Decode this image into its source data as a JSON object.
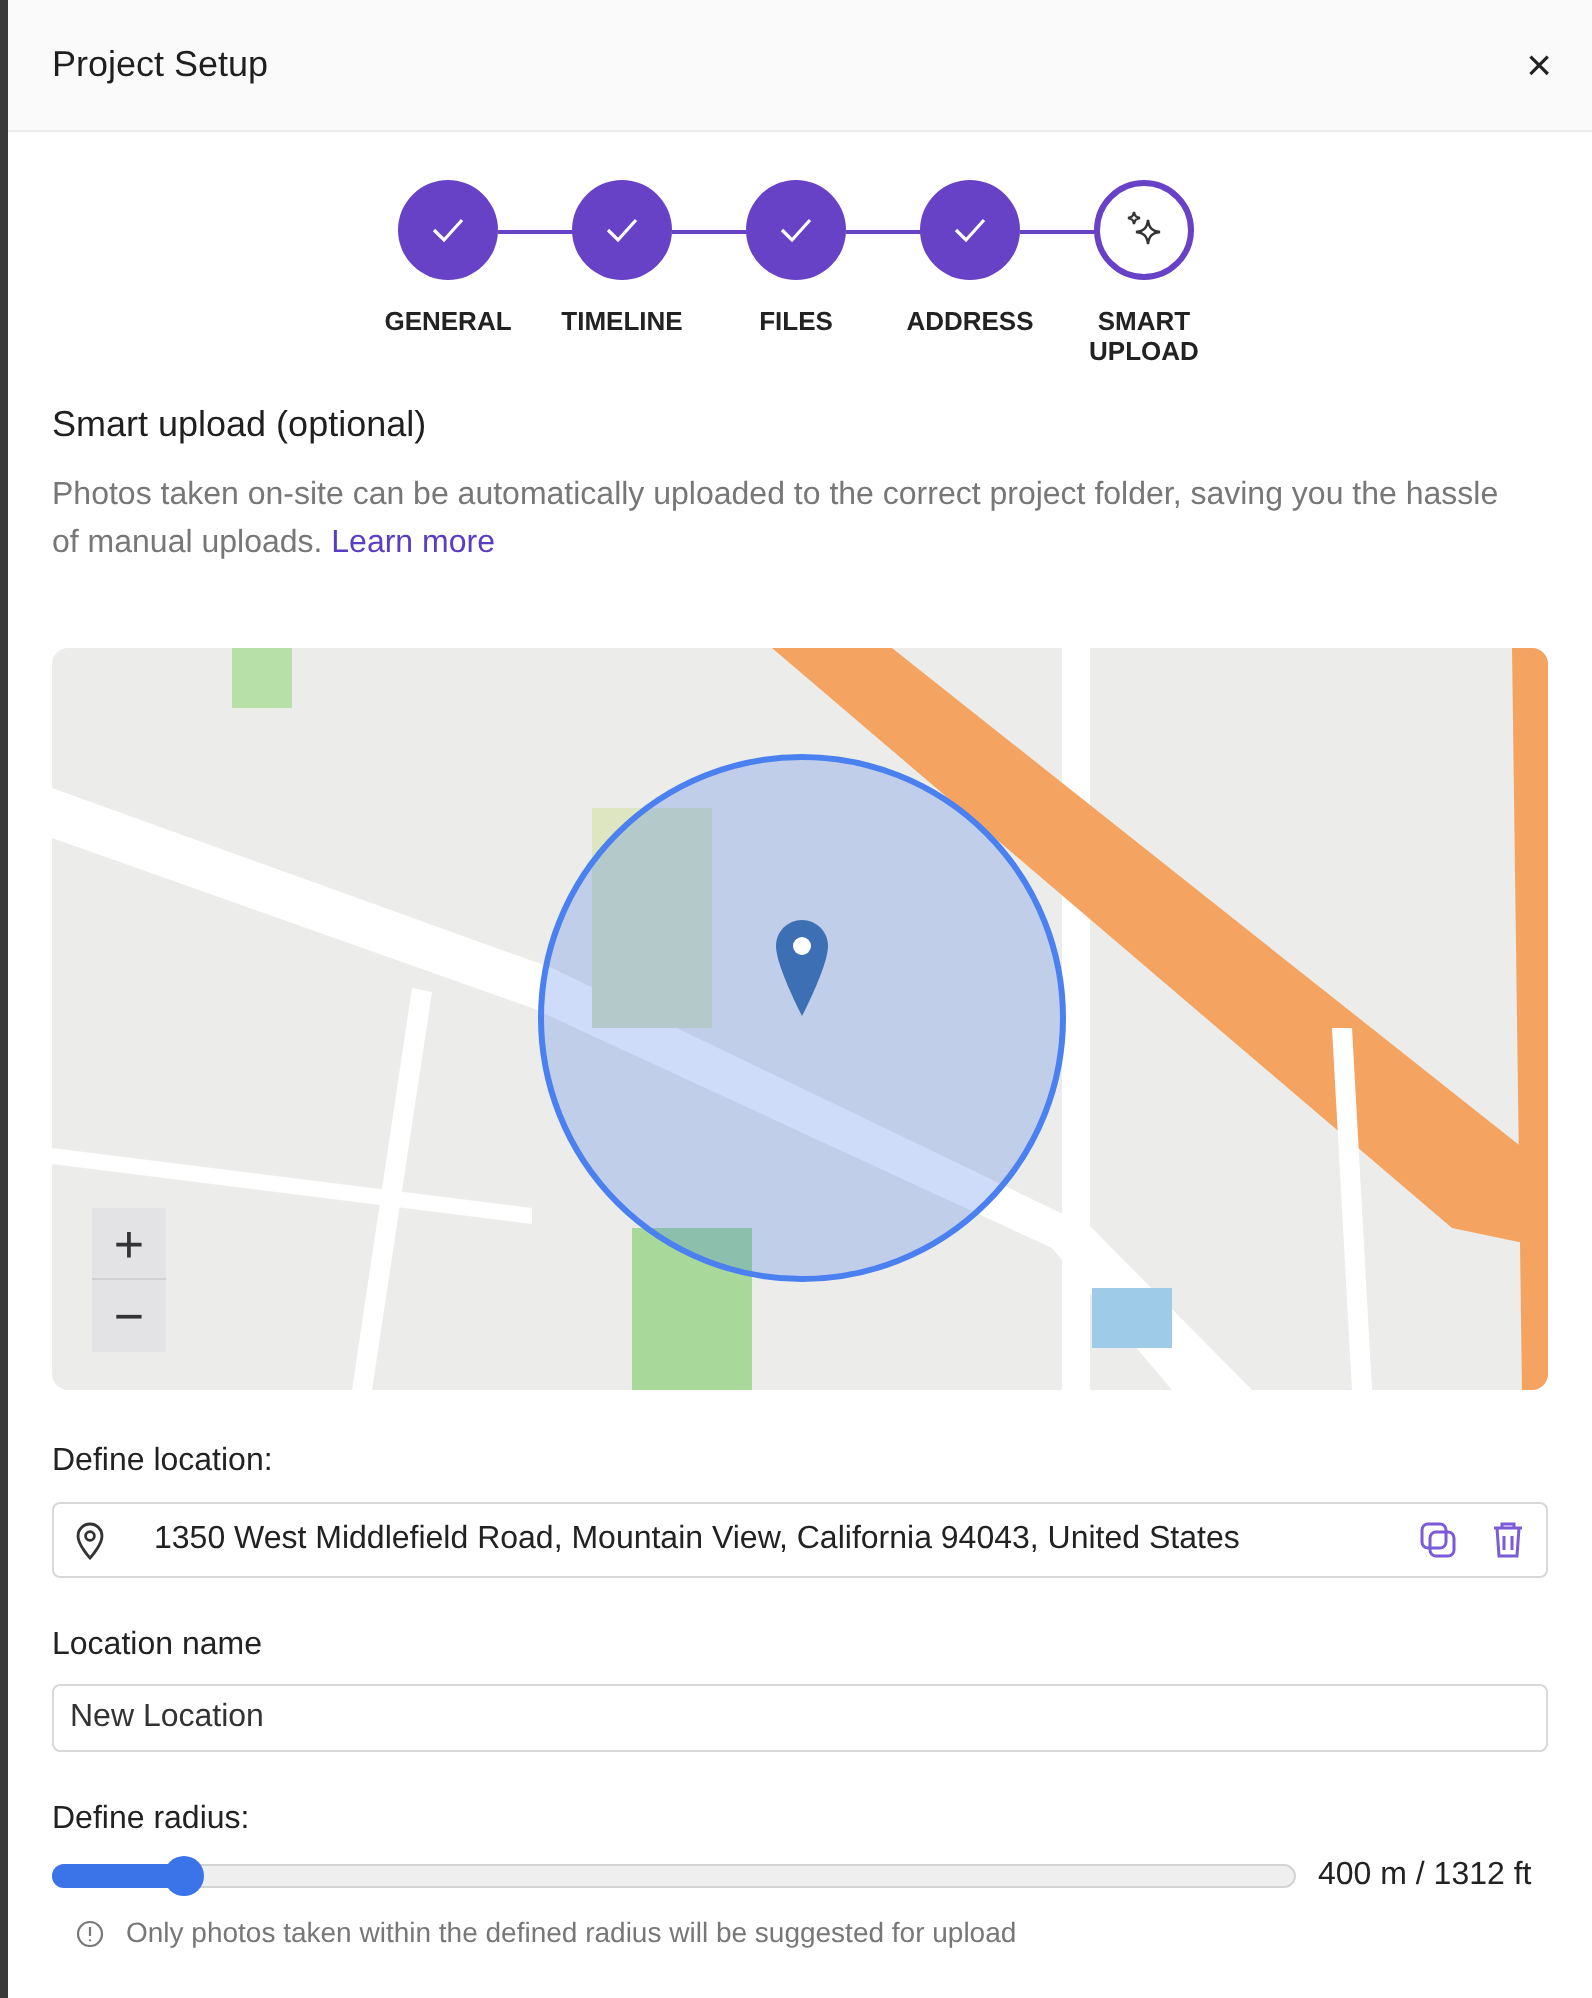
{
  "dialog": {
    "title": "Project Setup",
    "close": "×"
  },
  "steps": [
    {
      "label": "GENERAL",
      "completed": true
    },
    {
      "label": "TIMELINE",
      "completed": true
    },
    {
      "label": "FILES",
      "completed": true
    },
    {
      "label": "ADDRESS",
      "completed": true
    },
    {
      "label": "SMART UPLOAD",
      "completed": false
    }
  ],
  "section": {
    "heading": "Smart upload (optional)",
    "description": "Photos taken on-site can be automatically uploaded to the correct project folder, saving you the hassle of manual uploads.",
    "link": "Learn more"
  },
  "map": {
    "kind": "picture",
    "zoom_in": "+",
    "zoom_out": "−"
  },
  "location": {
    "label": "Define location:",
    "value": "1350 West Middlefield Road, Mountain View, California 94043, United States"
  },
  "location_name": {
    "label": "Location name",
    "value": "New Location"
  },
  "radius": {
    "label": "Define radius:",
    "level": 0.09,
    "reading": "400 m / 1312 ft",
    "note": "Only photos taken within the defined radius will be suggested for upload"
  }
}
